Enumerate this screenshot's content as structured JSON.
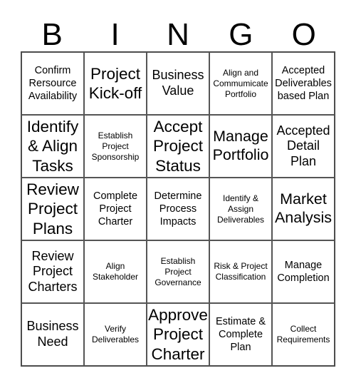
{
  "title_letters": [
    "B",
    "I",
    "N",
    "G",
    "O"
  ],
  "cells": [
    [
      "Confirm Rersource Availability",
      "Project Kick-off",
      "Business Value",
      "Align and Commumicate Portfolio",
      "Accepted Deliverables based Plan"
    ],
    [
      "Identify & Align Tasks",
      "Establish Project Sponsorship",
      "Accept Project Status",
      "Manage Portfolio",
      "Accepted Detail Plan"
    ],
    [
      "Review Project Plans",
      "Complete Project Charter",
      "Determine Process Impacts",
      "Identify & Assign Deliverables",
      "Market Analysis"
    ],
    [
      "Review Project Charters",
      "Align Stakeholder",
      "Establish Project Governance",
      "Risk & Project Classification",
      "Manage Completion"
    ],
    [
      "Business Need",
      "Verify Deliverables",
      "Approve Project Charter",
      "Estimate & Complete Plan",
      "Collect Requirements"
    ]
  ]
}
